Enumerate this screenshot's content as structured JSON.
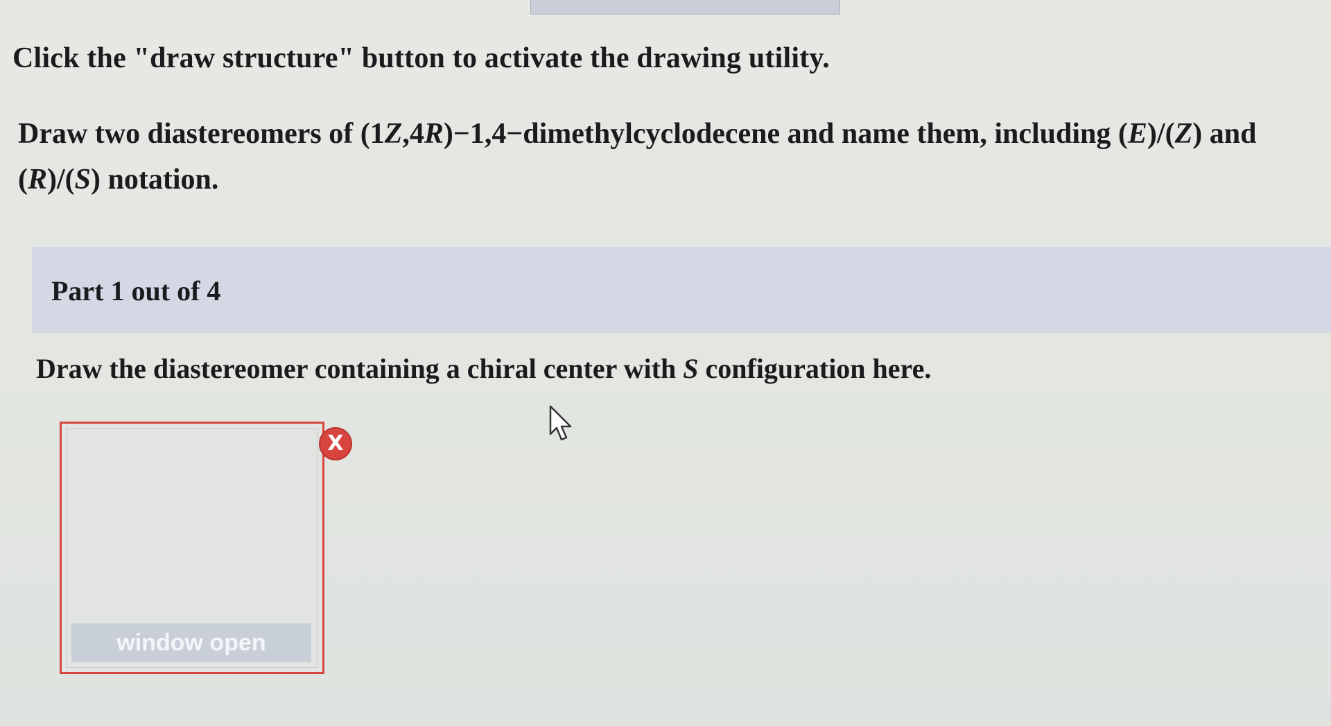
{
  "instruction": "Click the \"draw structure\" button to activate the drawing utility.",
  "question": {
    "prefix": "Draw two diastereomers of (1",
    "z1": "Z",
    "mid1": ",4",
    "r1": "R",
    "mid2": ")−1,4−dimethylcyclodecene and name them, including (",
    "e": "E",
    "mid3": ")/(",
    "z2": "Z",
    "mid4": ") and (",
    "r2": "R",
    "mid5": ")/(",
    "s": "S",
    "suffix": ") notation."
  },
  "part_label": "Part 1 out of 4",
  "prompt": {
    "before": "Draw the diastereomer containing a chiral center with ",
    "s": "S",
    "after": " configuration here."
  },
  "draw_box": {
    "button_label": "window open"
  },
  "close_button": {
    "label": "X",
    "color": "#d8453e"
  },
  "icons": {
    "cursor": "mouse-pointer-icon"
  }
}
